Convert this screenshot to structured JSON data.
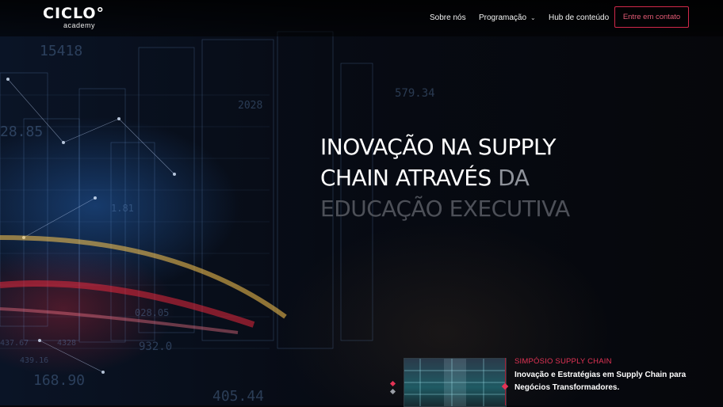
{
  "brand": {
    "logo_text": "CICLO°",
    "logo_sub": "academy"
  },
  "nav": {
    "items": [
      {
        "label": "Sobre nós",
        "has_dropdown": false
      },
      {
        "label": "Programação",
        "has_dropdown": true
      },
      {
        "label": "Hub de conteúdo",
        "has_dropdown": false
      }
    ],
    "cta_label": "Entre em contato",
    "chevron": "chevron-down-icon"
  },
  "hero": {
    "line1": "INOVAÇÃO NA SUPPLY",
    "line2_bright": "CHAIN ATRAVÉS ",
    "line2_dim": "DA",
    "line3": "EDUCAÇÃO EXECUTIVA",
    "background_numbers": [
      "15418",
      "579.34",
      "2028",
      "437.67",
      "168.90",
      "405.44",
      "439.16",
      "4328",
      "1.81",
      "028.05",
      "28.85",
      "932.0"
    ]
  },
  "event_card": {
    "eyebrow": "SIMPÓSIO SUPPLY CHAIN",
    "title": "Inovação e Estratégias em Supply Chain para Negócios Transformadores."
  },
  "colors": {
    "accent": "#e33355",
    "cta_border": "#d1284a",
    "background": "#06070b",
    "headline_dim": "#8e929a"
  }
}
